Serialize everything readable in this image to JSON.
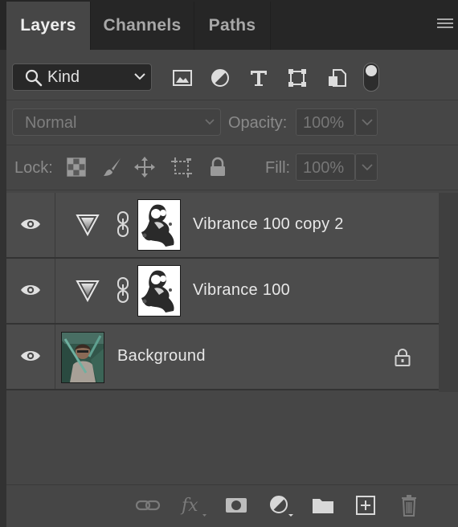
{
  "tabs": [
    {
      "label": "Layers",
      "active": true
    },
    {
      "label": "Channels",
      "active": false
    },
    {
      "label": "Paths",
      "active": false
    }
  ],
  "panel_menu_icon": "hamburger-menu-icon",
  "filter": {
    "kind_label": "Kind",
    "icons": [
      "pixel-layer-filter-icon",
      "adjustment-layer-filter-icon",
      "type-layer-filter-icon",
      "shape-layer-filter-icon",
      "smart-object-filter-icon"
    ],
    "toggle_on": true
  },
  "blend": {
    "mode": "Normal",
    "opacity_label": "Opacity:",
    "opacity_value": "100%"
  },
  "lock": {
    "label": "Lock:",
    "icons": [
      "lock-transparent-pixels-icon",
      "lock-image-pixels-icon",
      "lock-position-icon",
      "lock-artboard-icon",
      "lock-all-icon"
    ],
    "fill_label": "Fill:",
    "fill_value": "100%"
  },
  "layers": [
    {
      "name": "Vibrance 100 copy 2",
      "type": "adjustment",
      "visible": true
    },
    {
      "name": "Vibrance 100",
      "type": "adjustment",
      "visible": true
    },
    {
      "name": "Background",
      "type": "image",
      "visible": true,
      "locked": true
    }
  ],
  "bottom_toolbar": [
    "link-layers-icon",
    "fx-icon",
    "add-mask-icon",
    "adjustment-layer-icon",
    "group-folder-icon",
    "new-layer-icon",
    "trash-icon"
  ],
  "colors": {
    "panel_bg": "#464646",
    "tabbar_bg": "#262626",
    "row_bg": "#4c4c4c"
  }
}
